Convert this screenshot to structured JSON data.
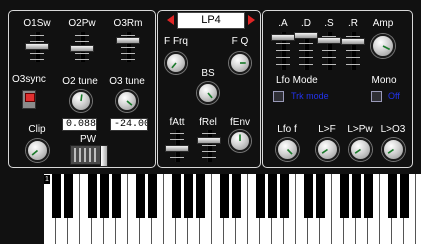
{
  "osc": {
    "o1sw_label": "O1Sw",
    "o2pw_label": "O2Pw",
    "o3rm_label": "O3Rm",
    "o3sync_label": "O3sync",
    "o2tune_label": "O2 tune",
    "o3tune_label": "O3 tune",
    "o2tune_value": "0.088",
    "o3tune_value": "-24.000",
    "clip_label": "Clip",
    "pw_label": "PW"
  },
  "filter": {
    "type": "LP4",
    "ffrq_label": "F Frq",
    "fq_label": "F Q",
    "bs_label": "BS",
    "fatt_label": "fAtt",
    "frel_label": "fRel",
    "fenv_label": "fEnv"
  },
  "env": {
    "a_label": ".A",
    "d_label": ".D",
    "s_label": ".S",
    "r_label": ".R",
    "amp_label": "Amp"
  },
  "lfo": {
    "mode_label": "Lfo Mode",
    "mode_value": "Trk mode",
    "mono_label": "Mono",
    "mono_value": "Off",
    "lfof_label": "Lfo f",
    "lf_label": "L>F",
    "lpw_label": "L>Pw",
    "lo3_label": "L>O3"
  },
  "keyboard": {
    "octave_marker": "1"
  },
  "colors": {
    "background": "#111111",
    "panel_border": "#d8d8d8",
    "label": "#ffffff",
    "arrow": "#e02525",
    "checkbox_text": "#2233ee",
    "knob_indicator": "#1a7a2a"
  }
}
